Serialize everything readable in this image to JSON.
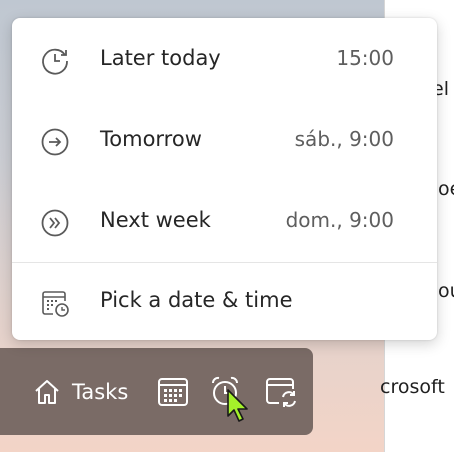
{
  "menu": {
    "items": [
      {
        "label": "Later today",
        "time": "15:00",
        "icon": "clock-icon"
      },
      {
        "label": "Tomorrow",
        "time": "sáb., 9:00",
        "icon": "arrow-right-circle-icon"
      },
      {
        "label": "Next week",
        "time": "dom., 9:00",
        "icon": "double-chevron-circle-icon"
      },
      {
        "label": "Pick a date & time",
        "icon": "calendar-clock-icon"
      }
    ]
  },
  "toolbar": {
    "tasks_label": "Tasks",
    "icons": [
      "home-icon",
      "calendar-icon",
      "alarm-clock-icon",
      "calendar-repeat-icon"
    ]
  },
  "background": {
    "fragments": [
      "el",
      "oe",
      "ou",
      "crosoft"
    ]
  },
  "colors": {
    "toolbar_bg": "#7a6b66",
    "cursor": "#a4f12a"
  }
}
